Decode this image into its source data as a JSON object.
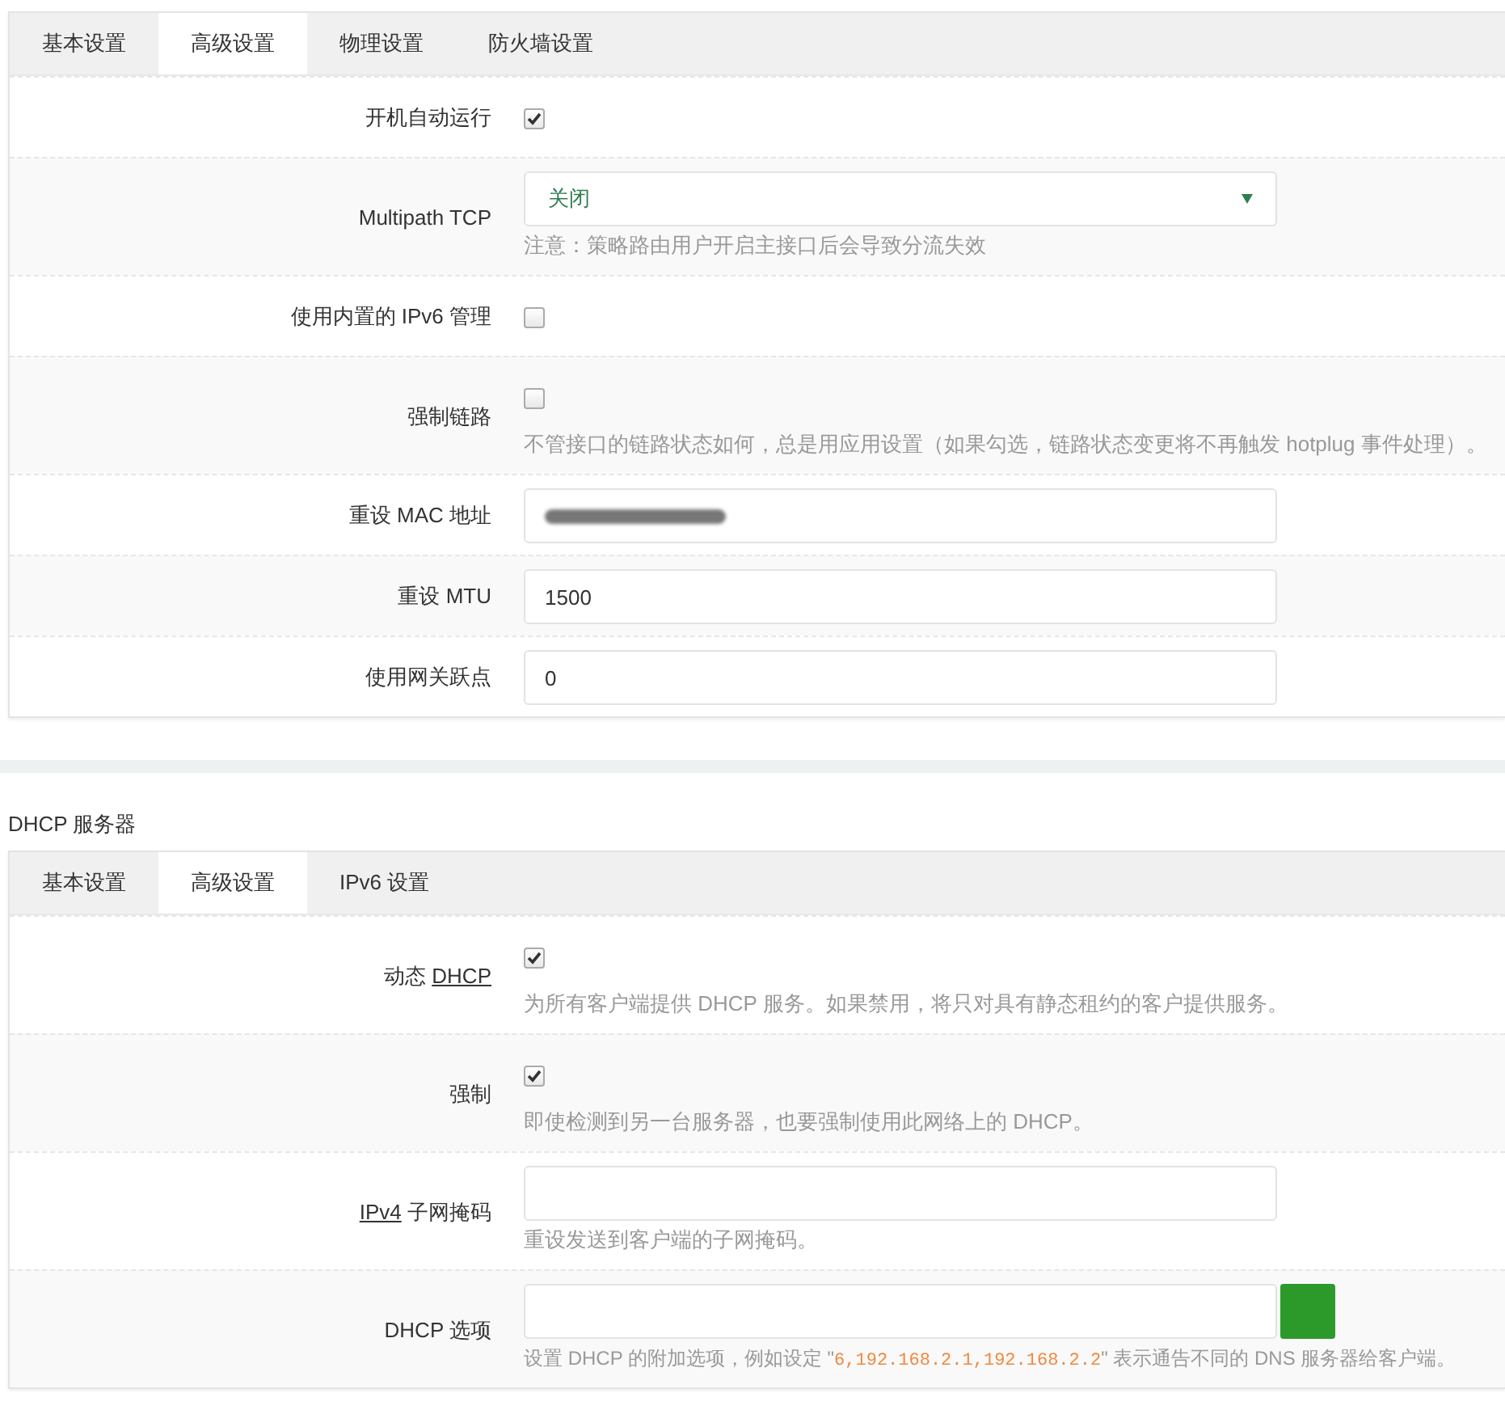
{
  "sections": [
    {
      "tabs": [
        {
          "label": "基本设置",
          "selected": false
        },
        {
          "label": "高级设置",
          "selected": true
        },
        {
          "label": "物理设置",
          "selected": false
        },
        {
          "label": "防火墙设置",
          "selected": false
        }
      ],
      "fields": [
        {
          "kind": "checkbox",
          "label": "开机自动运行",
          "checked": true
        },
        {
          "kind": "select",
          "label": "Multipath TCP",
          "value": "关闭",
          "hint": "注意：策略路由用户开启主接口后会导致分流失效"
        },
        {
          "kind": "checkbox",
          "label": "使用内置的 IPv6 管理",
          "checked": false
        },
        {
          "kind": "checkbox",
          "label": "强制链路",
          "checked": false,
          "hint": "不管接口的链路状态如何，总是用应用设置（如果勾选，链路状态变更将不再触发 hotplug 事件处理）。"
        },
        {
          "kind": "redacted",
          "label": "重设 MAC 地址"
        },
        {
          "kind": "text",
          "label": "重设 MTU",
          "value": "1500"
        },
        {
          "kind": "text",
          "label": "使用网关跃点",
          "value": "0"
        }
      ]
    },
    {
      "title": "DHCP 服务器",
      "tabs": [
        {
          "label": "基本设置",
          "selected": false
        },
        {
          "label": "高级设置",
          "selected": true
        },
        {
          "label": "IPv6 设置",
          "selected": false
        }
      ],
      "fields": [
        {
          "kind": "checkbox",
          "label_parts": [
            {
              "text": "动态 ",
              "kind": "text"
            },
            {
              "text": "DHCP",
              "kind": "abbr"
            }
          ],
          "checked": true,
          "hint": "为所有客户端提供 DHCP 服务。如果禁用，将只对具有静态租约的客户提供服务。"
        },
        {
          "kind": "checkbox",
          "label": "强制",
          "checked": true,
          "hint": "即使检测到另一台服务器，也要强制使用此网络上的 DHCP。"
        },
        {
          "kind": "text",
          "label_parts": [
            {
              "text": "IPv4",
              "kind": "abbr"
            },
            {
              "text": " 子网掩码",
              "kind": "text"
            }
          ],
          "hint": "重设发送到客户端的子网掩码。"
        },
        {
          "kind": "list",
          "label": "DHCP 选项",
          "hint_parts": [
            {
              "kind": "text",
              "text": "设置 DHCP 的附加选项，例如设定 \""
            },
            {
              "kind": "code",
              "text": "6,192.168.2.1,192.168.2.2"
            },
            {
              "kind": "text",
              "text": "\" 表示通告不同的 DNS 服务器给客户端。"
            }
          ]
        }
      ]
    }
  ]
}
